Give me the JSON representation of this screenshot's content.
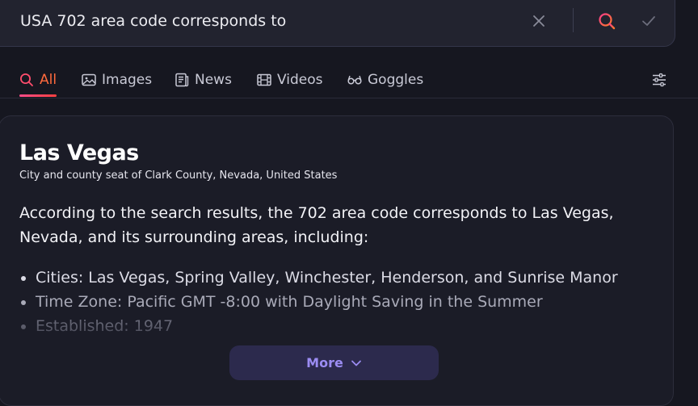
{
  "search": {
    "query": "USA 702 area code corresponds to"
  },
  "tabs": [
    {
      "label": "All",
      "icon": "search-icon",
      "active": true
    },
    {
      "label": "Images",
      "icon": "image-icon",
      "active": false
    },
    {
      "label": "News",
      "icon": "news-icon",
      "active": false
    },
    {
      "label": "Videos",
      "icon": "film-icon",
      "active": false
    },
    {
      "label": "Goggles",
      "icon": "goggles-icon",
      "active": false
    }
  ],
  "result": {
    "title": "Las Vegas",
    "subtitle": "City and county seat of Clark County, Nevada, United States",
    "answer": "According to the search results, the 702 area code corresponds to Las Vegas, Nevada, and its surrounding areas, including:",
    "bullets": [
      "Cities: Las Vegas, Spring Valley, Winchester, Henderson, and Sunrise Manor",
      "Time Zone: Pacific GMT -8:00 with Daylight Saving in the Summer",
      "Established: 1947"
    ],
    "more_label": "More"
  },
  "colors": {
    "background": "#161720",
    "accent_active_tab": "#ff6a3d",
    "search_icon_gradient": [
      "#ff3d8a",
      "#ff7a2a"
    ],
    "more_button_text": "#9b8cf2"
  }
}
